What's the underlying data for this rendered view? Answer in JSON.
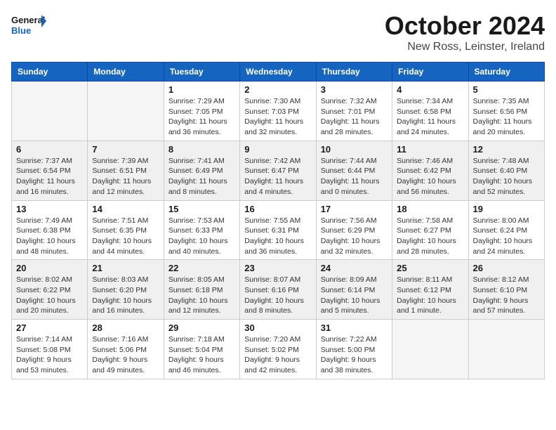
{
  "logo": {
    "general": "General",
    "blue": "Blue"
  },
  "title": {
    "month": "October 2024",
    "location": "New Ross, Leinster, Ireland"
  },
  "days_of_week": [
    "Sunday",
    "Monday",
    "Tuesday",
    "Wednesday",
    "Thursday",
    "Friday",
    "Saturday"
  ],
  "weeks": [
    [
      {
        "day": "",
        "info": ""
      },
      {
        "day": "",
        "info": ""
      },
      {
        "day": "1",
        "info": "Sunrise: 7:29 AM\nSunset: 7:05 PM\nDaylight: 11 hours\nand 36 minutes."
      },
      {
        "day": "2",
        "info": "Sunrise: 7:30 AM\nSunset: 7:03 PM\nDaylight: 11 hours\nand 32 minutes."
      },
      {
        "day": "3",
        "info": "Sunrise: 7:32 AM\nSunset: 7:01 PM\nDaylight: 11 hours\nand 28 minutes."
      },
      {
        "day": "4",
        "info": "Sunrise: 7:34 AM\nSunset: 6:58 PM\nDaylight: 11 hours\nand 24 minutes."
      },
      {
        "day": "5",
        "info": "Sunrise: 7:35 AM\nSunset: 6:56 PM\nDaylight: 11 hours\nand 20 minutes."
      }
    ],
    [
      {
        "day": "6",
        "info": "Sunrise: 7:37 AM\nSunset: 6:54 PM\nDaylight: 11 hours\nand 16 minutes."
      },
      {
        "day": "7",
        "info": "Sunrise: 7:39 AM\nSunset: 6:51 PM\nDaylight: 11 hours\nand 12 minutes."
      },
      {
        "day": "8",
        "info": "Sunrise: 7:41 AM\nSunset: 6:49 PM\nDaylight: 11 hours\nand 8 minutes."
      },
      {
        "day": "9",
        "info": "Sunrise: 7:42 AM\nSunset: 6:47 PM\nDaylight: 11 hours\nand 4 minutes."
      },
      {
        "day": "10",
        "info": "Sunrise: 7:44 AM\nSunset: 6:44 PM\nDaylight: 11 hours\nand 0 minutes."
      },
      {
        "day": "11",
        "info": "Sunrise: 7:46 AM\nSunset: 6:42 PM\nDaylight: 10 hours\nand 56 minutes."
      },
      {
        "day": "12",
        "info": "Sunrise: 7:48 AM\nSunset: 6:40 PM\nDaylight: 10 hours\nand 52 minutes."
      }
    ],
    [
      {
        "day": "13",
        "info": "Sunrise: 7:49 AM\nSunset: 6:38 PM\nDaylight: 10 hours\nand 48 minutes."
      },
      {
        "day": "14",
        "info": "Sunrise: 7:51 AM\nSunset: 6:35 PM\nDaylight: 10 hours\nand 44 minutes."
      },
      {
        "day": "15",
        "info": "Sunrise: 7:53 AM\nSunset: 6:33 PM\nDaylight: 10 hours\nand 40 minutes."
      },
      {
        "day": "16",
        "info": "Sunrise: 7:55 AM\nSunset: 6:31 PM\nDaylight: 10 hours\nand 36 minutes."
      },
      {
        "day": "17",
        "info": "Sunrise: 7:56 AM\nSunset: 6:29 PM\nDaylight: 10 hours\nand 32 minutes."
      },
      {
        "day": "18",
        "info": "Sunrise: 7:58 AM\nSunset: 6:27 PM\nDaylight: 10 hours\nand 28 minutes."
      },
      {
        "day": "19",
        "info": "Sunrise: 8:00 AM\nSunset: 6:24 PM\nDaylight: 10 hours\nand 24 minutes."
      }
    ],
    [
      {
        "day": "20",
        "info": "Sunrise: 8:02 AM\nSunset: 6:22 PM\nDaylight: 10 hours\nand 20 minutes."
      },
      {
        "day": "21",
        "info": "Sunrise: 8:03 AM\nSunset: 6:20 PM\nDaylight: 10 hours\nand 16 minutes."
      },
      {
        "day": "22",
        "info": "Sunrise: 8:05 AM\nSunset: 6:18 PM\nDaylight: 10 hours\nand 12 minutes."
      },
      {
        "day": "23",
        "info": "Sunrise: 8:07 AM\nSunset: 6:16 PM\nDaylight: 10 hours\nand 8 minutes."
      },
      {
        "day": "24",
        "info": "Sunrise: 8:09 AM\nSunset: 6:14 PM\nDaylight: 10 hours\nand 5 minutes."
      },
      {
        "day": "25",
        "info": "Sunrise: 8:11 AM\nSunset: 6:12 PM\nDaylight: 10 hours\nand 1 minute."
      },
      {
        "day": "26",
        "info": "Sunrise: 8:12 AM\nSunset: 6:10 PM\nDaylight: 9 hours\nand 57 minutes."
      }
    ],
    [
      {
        "day": "27",
        "info": "Sunrise: 7:14 AM\nSunset: 5:08 PM\nDaylight: 9 hours\nand 53 minutes."
      },
      {
        "day": "28",
        "info": "Sunrise: 7:16 AM\nSunset: 5:06 PM\nDaylight: 9 hours\nand 49 minutes."
      },
      {
        "day": "29",
        "info": "Sunrise: 7:18 AM\nSunset: 5:04 PM\nDaylight: 9 hours\nand 46 minutes."
      },
      {
        "day": "30",
        "info": "Sunrise: 7:20 AM\nSunset: 5:02 PM\nDaylight: 9 hours\nand 42 minutes."
      },
      {
        "day": "31",
        "info": "Sunrise: 7:22 AM\nSunset: 5:00 PM\nDaylight: 9 hours\nand 38 minutes."
      },
      {
        "day": "",
        "info": ""
      },
      {
        "day": "",
        "info": ""
      }
    ]
  ]
}
